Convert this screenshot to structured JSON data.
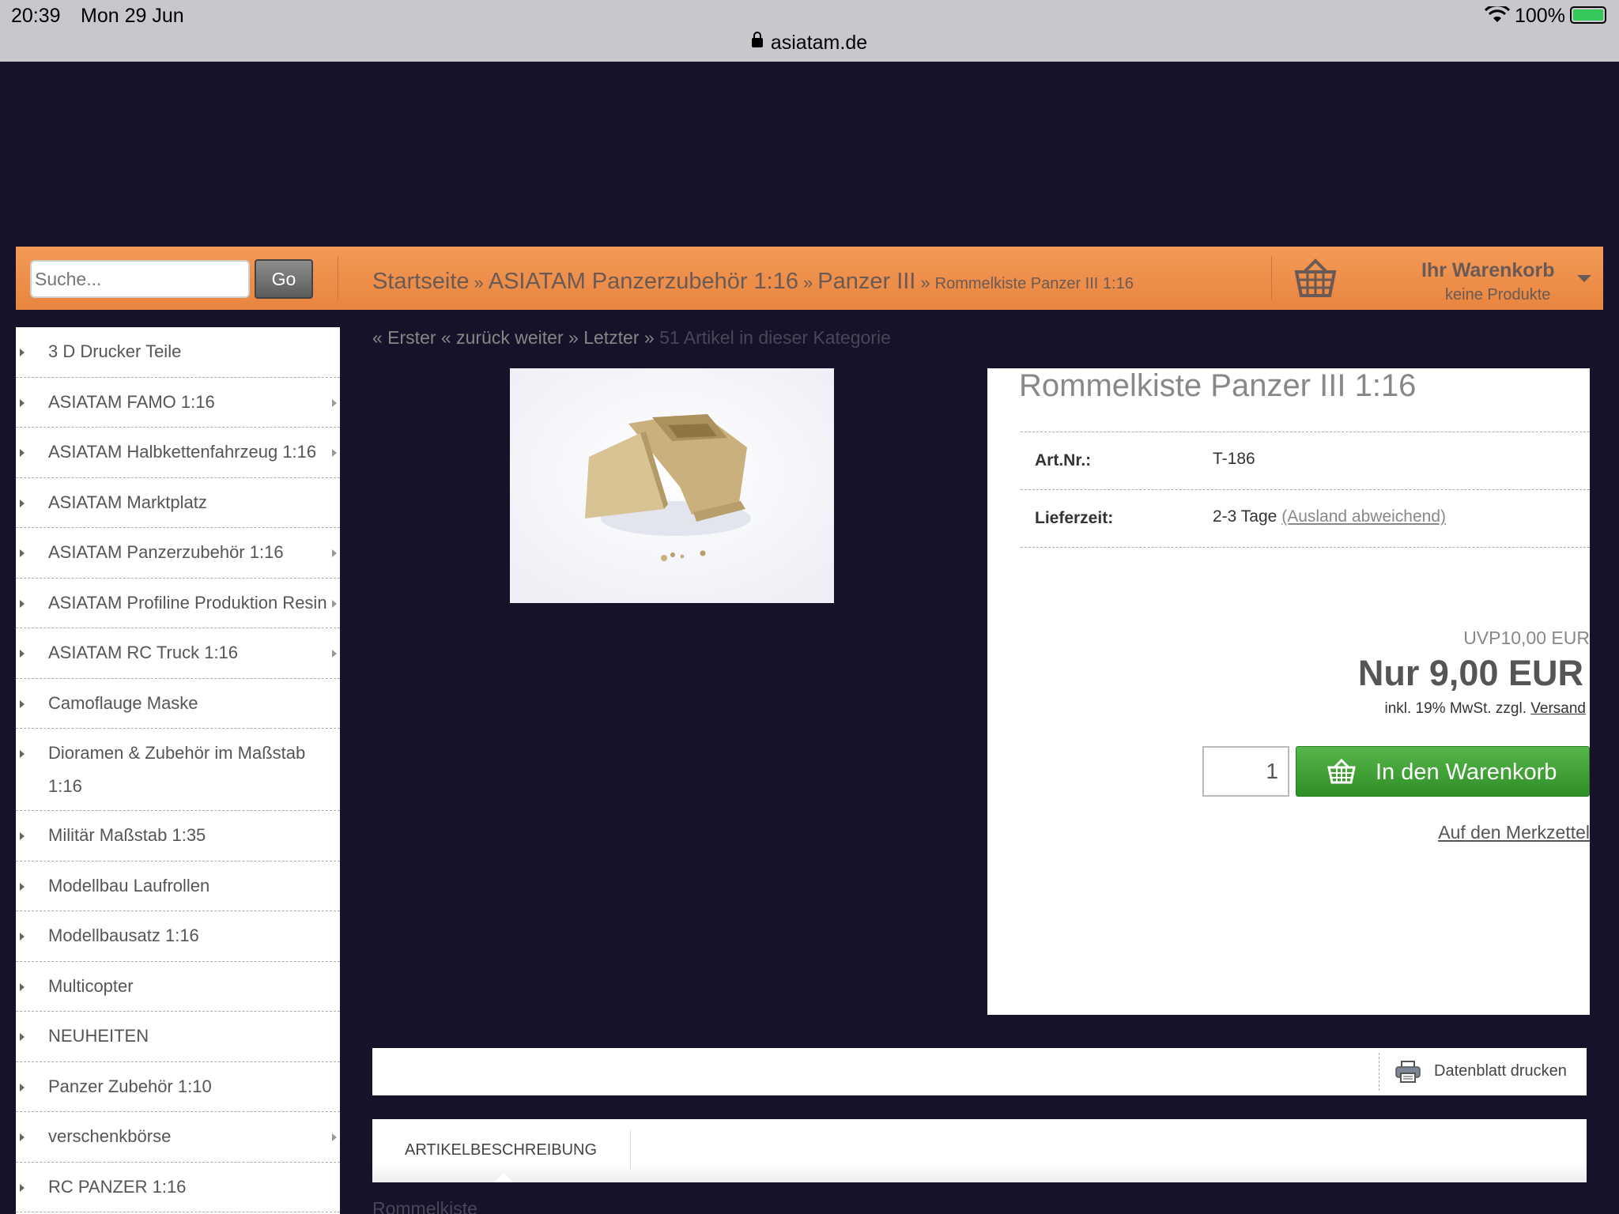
{
  "status_bar": {
    "time": "20:39",
    "date": "Mon 29 Jun",
    "url": "asiatam.de",
    "battery": "100%"
  },
  "header": {
    "search_placeholder": "Suche...",
    "go_label": "Go",
    "breadcrumb": {
      "home": "Startseite",
      "category": "ASIATAM Panzerzubehör 1:16",
      "subcategory": "Panzer III",
      "current": "Rommelkiste Panzer III 1:16"
    },
    "cart": {
      "title": "Ihr Warenkorb",
      "subtitle": "keine Produkte"
    }
  },
  "sidebar": {
    "items": [
      {
        "label": "3 D Drucker Teile",
        "has_sub": false
      },
      {
        "label": "ASIATAM FAMO 1:16",
        "has_sub": true
      },
      {
        "label": "ASIATAM Halbkettenfahrzeug 1:16",
        "has_sub": true
      },
      {
        "label": "ASIATAM Marktplatz",
        "has_sub": false
      },
      {
        "label": "ASIATAM Panzerzubehör 1:16",
        "has_sub": true
      },
      {
        "label": "ASIATAM Profiline Produktion Resin",
        "has_sub": true
      },
      {
        "label": "ASIATAM RC Truck 1:16",
        "has_sub": true
      },
      {
        "label": "Camoflauge Maske",
        "has_sub": false
      },
      {
        "label": "Dioramen & Zubehör im Maßstab 1:16",
        "has_sub": false
      },
      {
        "label": "Militär Maßstab 1:35",
        "has_sub": false
      },
      {
        "label": "Modellbau Laufrollen",
        "has_sub": false
      },
      {
        "label": "Modellbausatz 1:16",
        "has_sub": false
      },
      {
        "label": "Multicopter",
        "has_sub": false
      },
      {
        "label": "NEUHEITEN",
        "has_sub": false
      },
      {
        "label": "Panzer Zubehör 1:10",
        "has_sub": false
      },
      {
        "label": "verschenkbörse",
        "has_sub": true
      },
      {
        "label": "RC PANZER 1:16",
        "has_sub": false
      }
    ]
  },
  "pager": {
    "first": "« Erster",
    "back": "« zurück",
    "next": "weiter »",
    "last": "Letzter »",
    "count": "51 Artikel in dieser Kategorie"
  },
  "product": {
    "title": "Rommelkiste Panzer III 1:16",
    "art_nr_label": "Art.Nr.:",
    "art_nr": "T-186",
    "delivery_label": "Lieferzeit:",
    "delivery": "2-3 Tage",
    "delivery_note": "(Ausland abweichend)",
    "uvp": "UVP10,00 EUR",
    "price": "Nur 9,00 EUR",
    "tax_note": "inkl. 19% MwSt. zzgl.",
    "shipping_link": "Versand",
    "quantity": "1",
    "add_to_cart": "In den Warenkorb",
    "wishlist": "Auf den Merkzettel"
  },
  "print": {
    "label": "Datenblatt drucken"
  },
  "tabs": {
    "description": "ARTIKELBESCHREIBUNG",
    "snippet": "Rommelkiste"
  },
  "colors": {
    "page_bg": "#15122a",
    "header_orange": "#ec8c48",
    "cart_green": "#3fa135",
    "text_gray": "#555555"
  }
}
